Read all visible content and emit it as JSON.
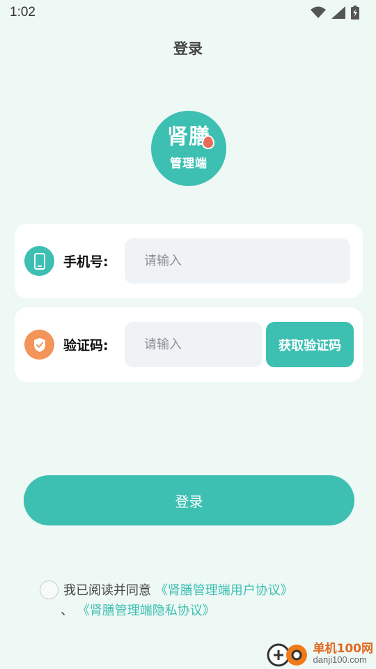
{
  "status_bar": {
    "time": "1:02",
    "icons": [
      "wifi-icon",
      "signal-icon",
      "battery-charging-icon"
    ]
  },
  "header": {
    "title": "登录"
  },
  "logo": {
    "main_text": "肾膳",
    "sub_text": "管理端",
    "bg_color": "#3dbfb2"
  },
  "form": {
    "phone": {
      "label": "手机号:",
      "placeholder": "请输入",
      "icon": "phone-icon",
      "icon_color": "#3dbfb2"
    },
    "code": {
      "label": "验证码:",
      "placeholder": "请输入",
      "icon": "shield-check-icon",
      "icon_color": "#f3945a",
      "get_code_label": "获取验证码"
    }
  },
  "login_button": {
    "label": "登录"
  },
  "agreement": {
    "prefix": "我已阅读并同意",
    "user_agreement": "《肾膳管理端用户协议》",
    "separator": "、",
    "privacy_agreement": "《肾膳管理端隐私协议》"
  },
  "watermark": {
    "cn": "单机100网",
    "en": "danji100.com"
  },
  "colors": {
    "accent": "#3dbfb2",
    "background": "#eef8f5",
    "input_bg": "#f0f3f6",
    "orange": "#f3945a"
  }
}
